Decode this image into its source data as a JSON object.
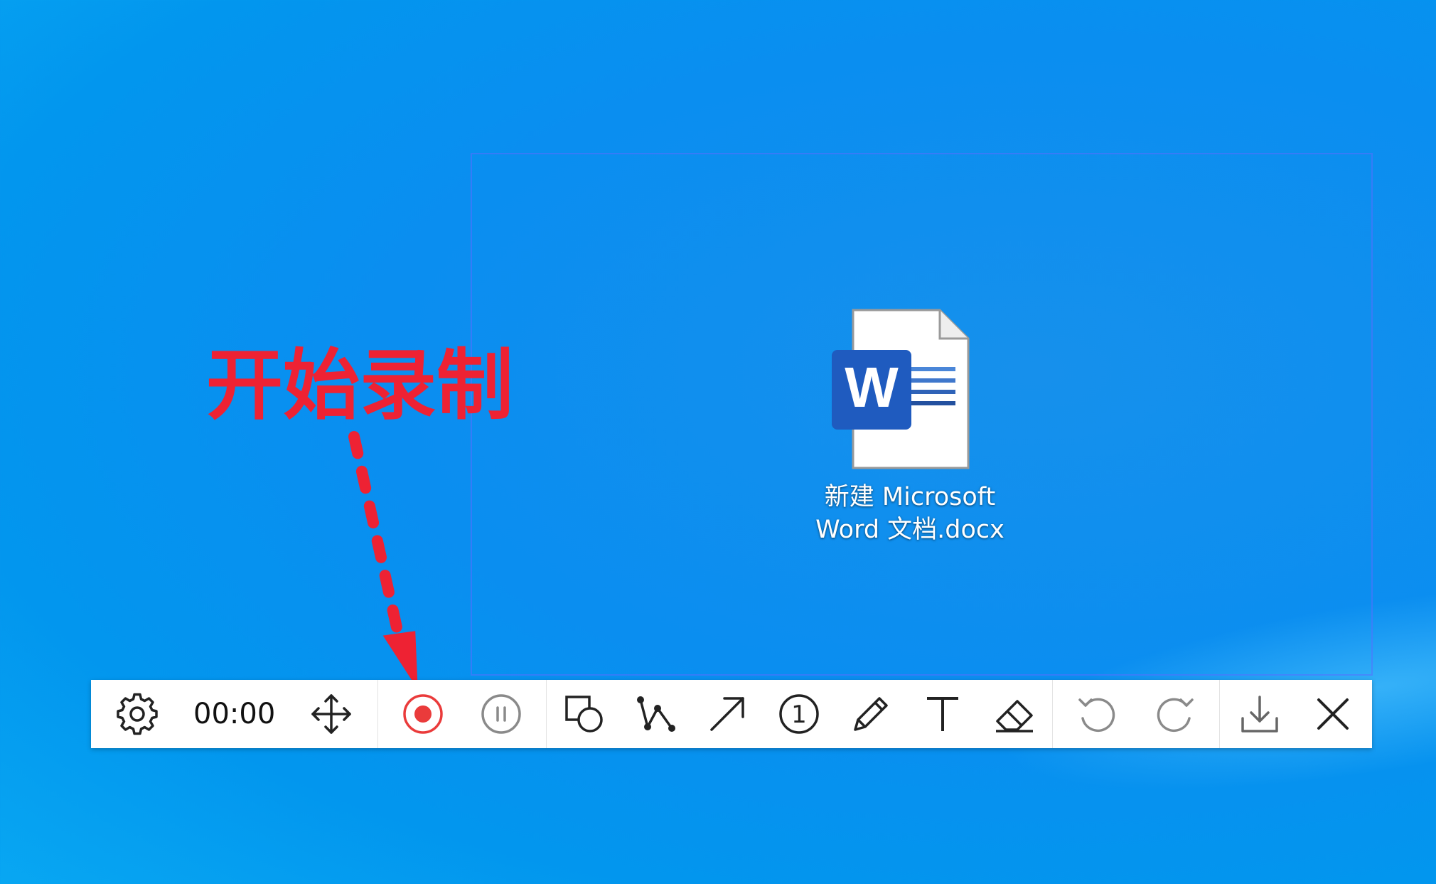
{
  "desktop": {
    "file": {
      "name_line1": "新建 Microsoft",
      "name_line2": "Word 文档.docx",
      "icon": "word-document-icon",
      "badge_letter": "W"
    }
  },
  "annotation": {
    "text": "开始录制",
    "color": "#ee2233"
  },
  "toolbar": {
    "timer": "00:00",
    "buttons": [
      {
        "name": "settings",
        "icon": "gear-icon"
      },
      {
        "name": "move",
        "icon": "move-arrows-icon"
      },
      {
        "name": "record",
        "icon": "record-icon",
        "color": "#ea3b3b"
      },
      {
        "name": "pause",
        "icon": "pause-icon"
      },
      {
        "name": "shape",
        "icon": "shape-tool-icon"
      },
      {
        "name": "polyline",
        "icon": "polyline-tool-icon"
      },
      {
        "name": "arrow",
        "icon": "arrow-tool-icon"
      },
      {
        "name": "number-marker",
        "icon": "number-marker-icon",
        "label": "1"
      },
      {
        "name": "pencil",
        "icon": "pencil-icon"
      },
      {
        "name": "text",
        "icon": "text-tool-icon"
      },
      {
        "name": "eraser",
        "icon": "eraser-icon"
      },
      {
        "name": "undo",
        "icon": "undo-icon"
      },
      {
        "name": "redo",
        "icon": "redo-icon"
      },
      {
        "name": "download",
        "icon": "download-icon"
      },
      {
        "name": "close",
        "icon": "close-icon"
      }
    ]
  }
}
